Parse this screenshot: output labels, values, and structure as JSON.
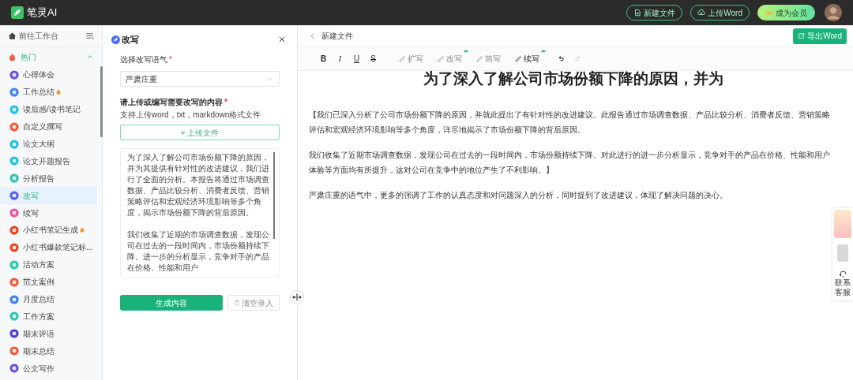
{
  "app": {
    "name": "笔灵AI"
  },
  "header_buttons": [
    {
      "label": "新建文件",
      "kind": "outline"
    },
    {
      "label": "上传Word",
      "kind": "outline"
    },
    {
      "label": "成为会员",
      "kind": "member"
    }
  ],
  "sidebar": {
    "home": "前往工作台",
    "group": {
      "label": "热门",
      "expanded": true
    },
    "items": [
      {
        "label": "心得体会",
        "color": "#6d4fe0",
        "hot": false,
        "selected": false
      },
      {
        "label": "工作总结",
        "color": "#3b82f6",
        "hot": true,
        "selected": false
      },
      {
        "label": "读后感/读书笔记",
        "color": "#22c1e0",
        "hot": false,
        "selected": false
      },
      {
        "label": "自定义撰写",
        "color": "#f05a3a",
        "hot": false,
        "selected": false
      },
      {
        "label": "论文大纲",
        "color": "#22c1e0",
        "hot": false,
        "selected": false
      },
      {
        "label": "论文开题报告",
        "color": "#22c1e0",
        "hot": false,
        "selected": false
      },
      {
        "label": "分析报告",
        "color": "#2cc7a8",
        "hot": false,
        "selected": false
      },
      {
        "label": "改写",
        "color": "#5b5ff0",
        "hot": false,
        "selected": true
      },
      {
        "label": "续写",
        "color": "#f0509a",
        "hot": false,
        "selected": false
      },
      {
        "label": "小红书笔记生成",
        "color": "#e8461e",
        "hot": true,
        "selected": false
      },
      {
        "label": "小红书爆款笔记标...",
        "color": "#e8461e",
        "hot": false,
        "selected": false
      },
      {
        "label": "活动方案",
        "color": "#2cc7a8",
        "hot": false,
        "selected": false
      },
      {
        "label": "范文案例",
        "color": "#f05a3a",
        "hot": false,
        "selected": false
      },
      {
        "label": "月度总结",
        "color": "#3b82f6",
        "hot": false,
        "selected": false
      },
      {
        "label": "工作方案",
        "color": "#2cc7a8",
        "hot": false,
        "selected": false
      },
      {
        "label": "期末评语",
        "color": "#4b3fd8",
        "hot": false,
        "selected": false
      },
      {
        "label": "期末总结",
        "color": "#f05a3a",
        "hot": false,
        "selected": false
      },
      {
        "label": "公文写作",
        "color": "#6d4fe0",
        "hot": false,
        "selected": false
      }
    ]
  },
  "panel": {
    "title": "改写",
    "tone_label": "选择改写语气",
    "tone_mark": "*",
    "content_mark": "*",
    "tone_value": "严肃庄重",
    "content_label": "请上传或编写需要改写的内容",
    "hint": "支持上传word，txt，markdown格式文件",
    "upload_button": "+ 上传文件",
    "paragraphs": [
      "为了深入了解公司市场份额下降的原因，并为其提供有针对性的改进建议，我们进行了全面的分析。本报告将通过市场调查数据、产品比较分析、消费者反馈、营销策略评估和宏观经济环境影响等多个角度，揭示市场份额下降的背后原因。",
      "我们收集了近期的市场调查数据，发现公司在过去的一段时间内，市场份额持续下降。进一步的分析显示，竞争对手的产品在价格、性能和用户"
    ],
    "generate_button": "生成内容",
    "clear_button": "清空录入"
  },
  "editor": {
    "back_label": "新建文件",
    "export_button": "导出Word",
    "toolbar": [
      {
        "label": "B",
        "kind": "format",
        "disabled": false
      },
      {
        "label": "I",
        "kind": "format",
        "disabled": false
      },
      {
        "label": "U",
        "kind": "format",
        "disabled": false
      },
      {
        "label": "S",
        "kind": "format",
        "disabled": false
      },
      {
        "label": "扩写",
        "kind": "ai",
        "disabled": true,
        "premium": false
      },
      {
        "label": "改写",
        "kind": "ai",
        "disabled": true,
        "premium": true
      },
      {
        "label": "简写",
        "kind": "ai",
        "disabled": true,
        "premium": false
      },
      {
        "label": "续写",
        "kind": "ai",
        "disabled": false,
        "premium": true
      },
      {
        "kind": "undo",
        "disabled": false
      },
      {
        "kind": "redo",
        "disabled": true
      }
    ],
    "heading": "为了深入了解公司市场份额下降的原因，并为",
    "paragraphs": [
      "【我们已深入分析了公司市场份额下降的原因，并就此提出了有针对性的改进建议。此报告通过市场调查数据、产品比较分析、消费者反馈、营销策略评估和宏观经济环境影响等多个角度，详尽地揭示了市场份额下降的背后原因。",
      "我们收集了近期市场调查数据，发现公司在过去的一段时间内，市场份额持续下降。对此进行的进一步分析显示，竞争对手的产品在价格、性能和用户体验等方面均有所提升，这对公司在竞争中的地位产生了不利影响。】",
      "严肃庄重的语气中，更多的强调了工作的认真态度和对问题深入的分析，同时提到了改进建议，体现了解决问题的决心。"
    ]
  },
  "support": {
    "label": "联系客服"
  }
}
